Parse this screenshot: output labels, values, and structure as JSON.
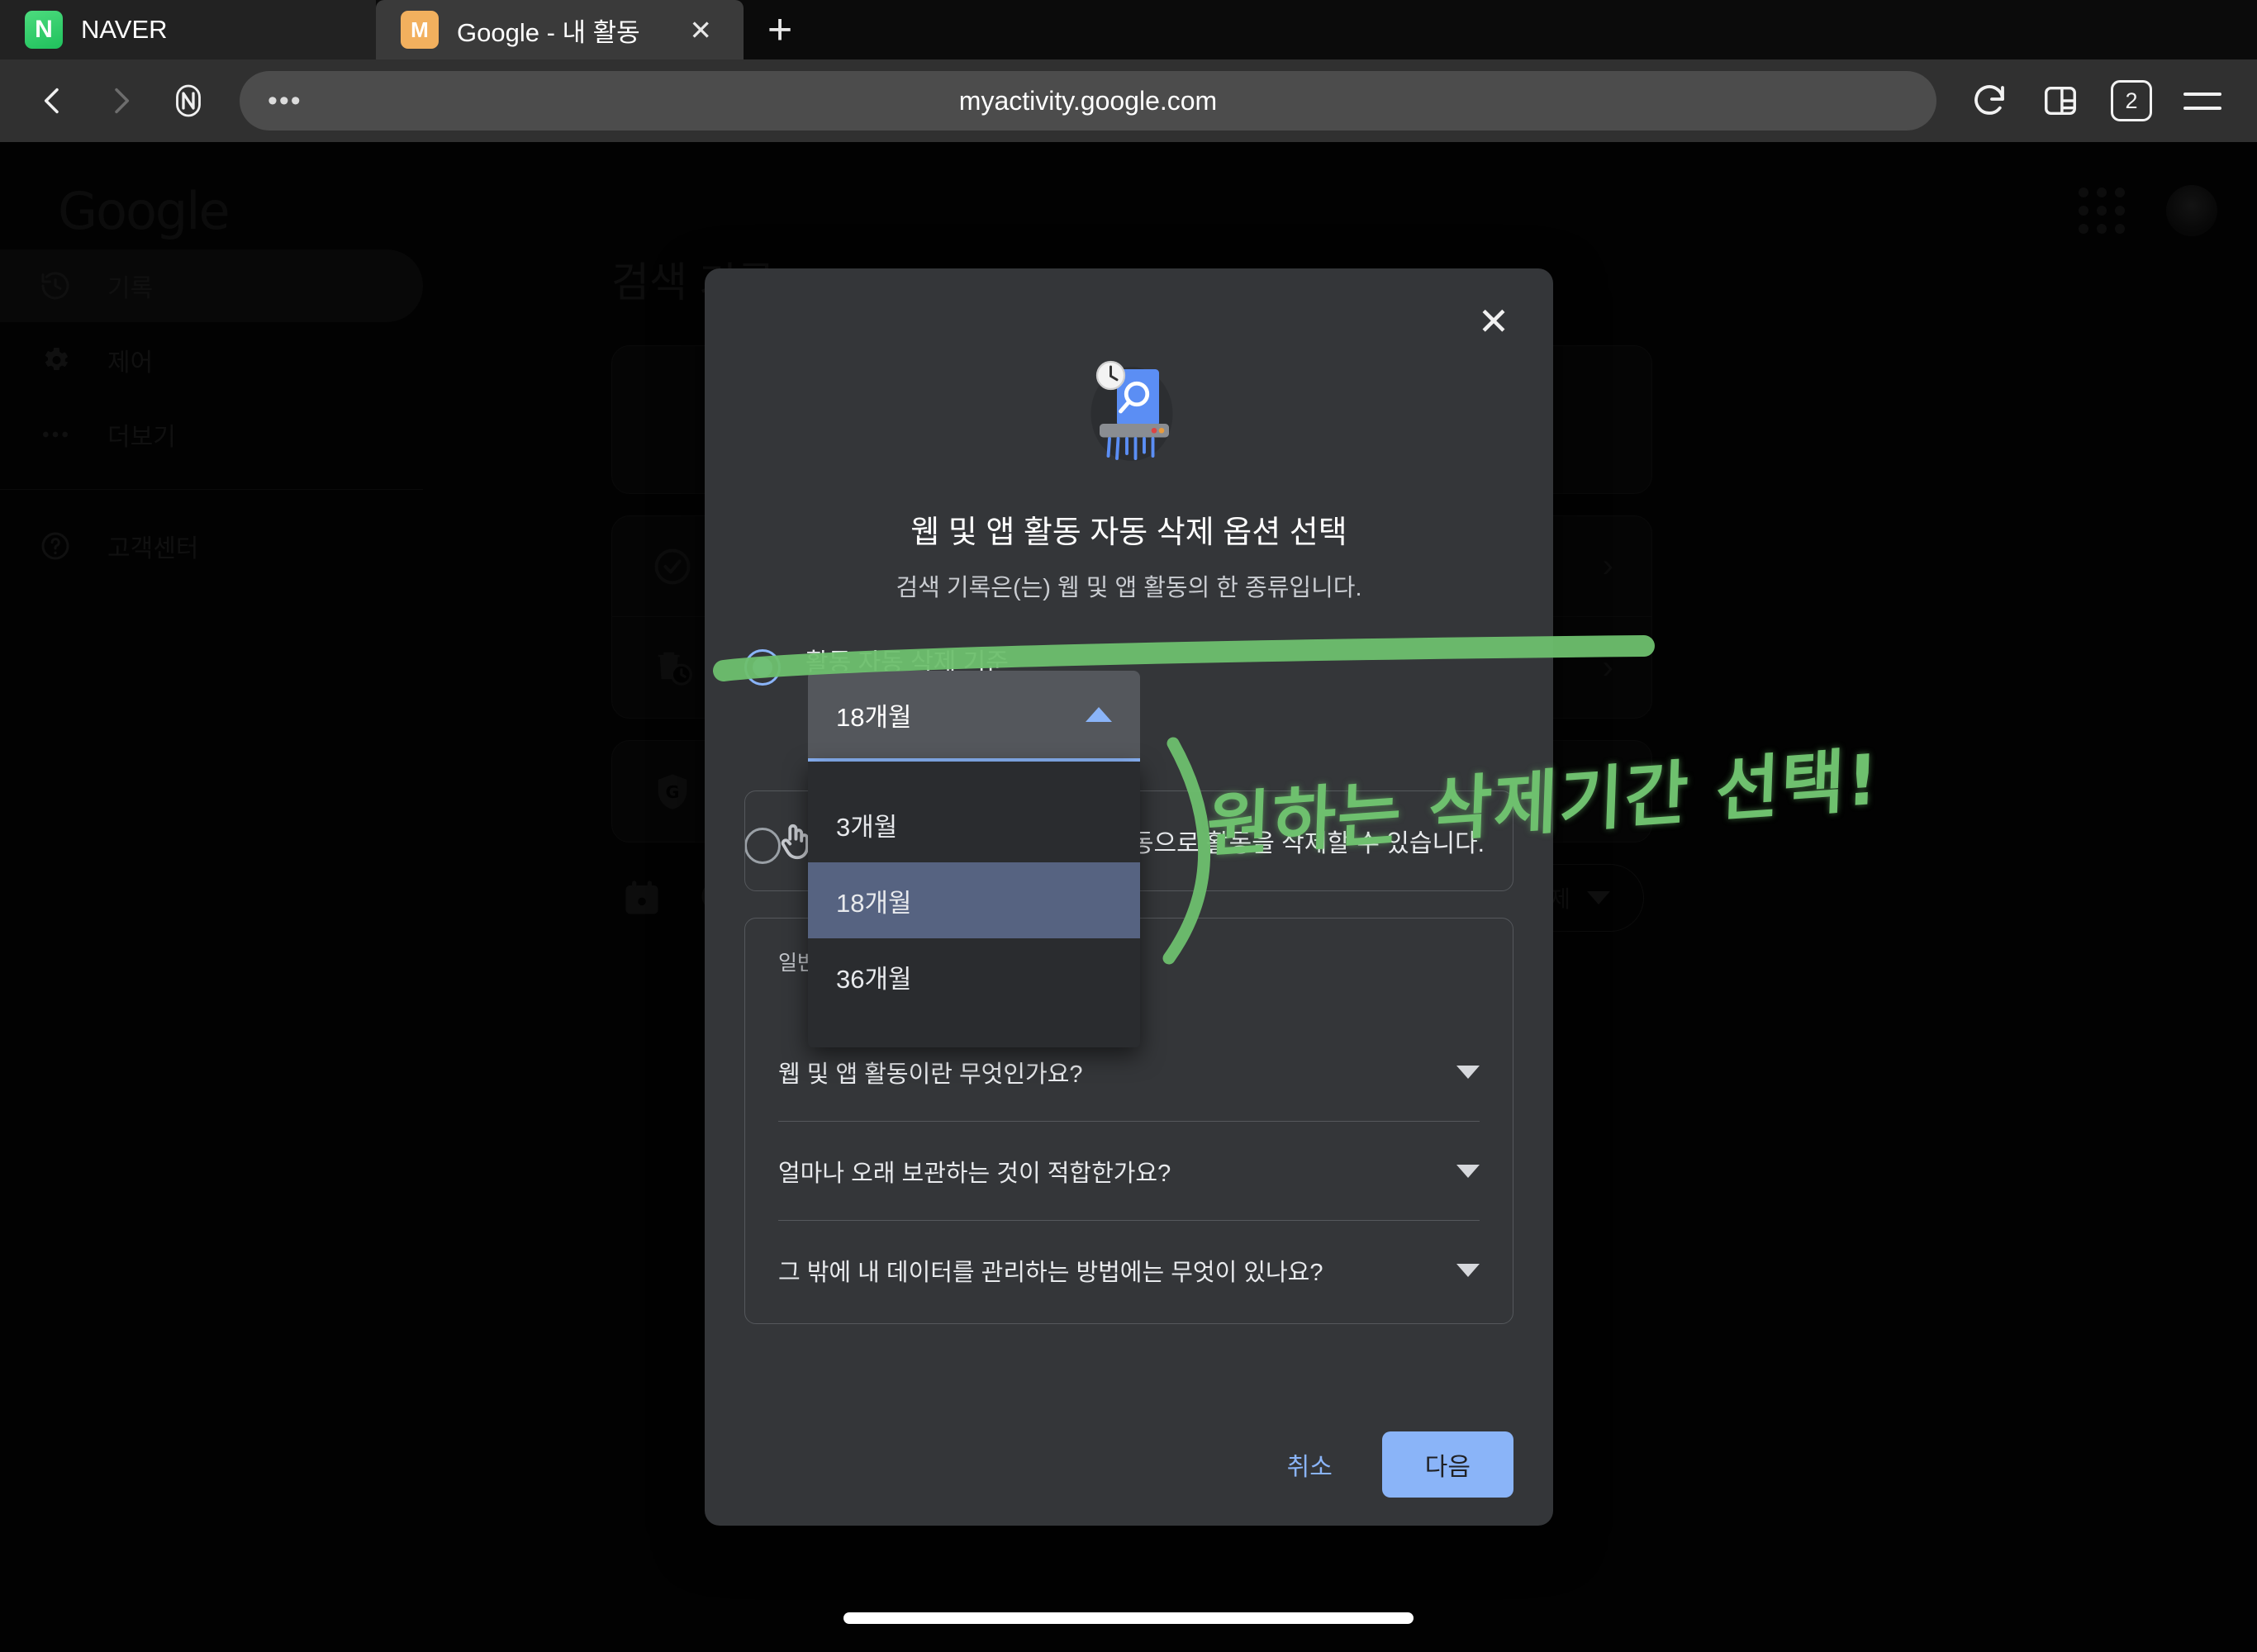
{
  "browser": {
    "tabs": [
      {
        "title": "NAVER",
        "favicon_letter": "N",
        "favicon": "naver-favicon",
        "active": false
      },
      {
        "title": "Google - 내 활동",
        "favicon_letter": "M",
        "favicon": "gmail-favicon",
        "active": true
      }
    ],
    "new_tab_label": "+",
    "close_label": "✕",
    "url": "myactivity.google.com",
    "url_overflow": "•••",
    "tab_count": "2",
    "icons": {
      "back": "back-arrow-icon",
      "forward": "forward-arrow-icon",
      "naver_shortcut": "naver-badge-icon",
      "reload": "reload-icon",
      "split_view": "split-view-icon",
      "tab_switcher": "tab-count-icon",
      "menu": "hamburger-menu-icon"
    }
  },
  "page": {
    "logo": "Google",
    "title": "검색 기록",
    "sidebar": [
      {
        "label": "기록",
        "icon": "history-icon",
        "active": true
      },
      {
        "label": "제어",
        "icon": "gear-icon",
        "active": false
      },
      {
        "label": "더보기",
        "icon": "ellipsis-icon",
        "active": false
      },
      {
        "label": "고객센터",
        "icon": "help-circle-icon",
        "active": false
      }
    ],
    "cards": [
      {
        "icon": "google-activity-ring-icon",
        "type": "hero"
      },
      {
        "icon": "check-circle-icon",
        "type": "row"
      },
      {
        "icon": "auto-delete-icon",
        "type": "row"
      },
      {
        "icon": "google-shield-icon",
        "type": "row"
      }
    ],
    "filter": {
      "date_icon": "calendar-icon",
      "search_icon": "search-icon",
      "delete_label": "삭제",
      "delete_caret": "chevron-down-icon"
    }
  },
  "modal": {
    "close_label": "✕",
    "illustration": "shredder-clock-search-icon",
    "title": "웹 및 앱 활동 자동 삭제 옵션 선택",
    "subtitle": "검색 기록은(는) 웹 및 앱 활동의 한 종류입니다.",
    "options": [
      {
        "label": "활동 자동 삭제 기준",
        "checked": true
      },
      {
        "label": "",
        "checked": false
      }
    ],
    "select": {
      "value": "18개월",
      "expanded": true,
      "caret": "caret-up-icon",
      "items": [
        {
          "label": "3개월",
          "selected": false
        },
        {
          "label": "18개월",
          "selected": true
        },
        {
          "label": "36개월",
          "selected": false
        }
      ]
    },
    "manual_note": {
      "icon": "hand-tap-icon",
      "text": "수동으로 활동을 삭제할 수 있습니다."
    },
    "faq": {
      "heading": "일반적인 질문",
      "items": [
        {
          "question": "웹 및 앱 활동이란 무엇인가요?",
          "caret": "chevron-down-icon"
        },
        {
          "question": "얼마나 오래 보관하는 것이 적합한가요?",
          "caret": "chevron-down-icon"
        },
        {
          "question": "그 밖에 내 데이터를 관리하는 방법에는 무엇이 있나요?",
          "caret": "chevron-down-icon"
        }
      ]
    },
    "footer": {
      "cancel_label": "취소",
      "next_label": "다음"
    }
  },
  "annotation": {
    "text": "원하는 삭제기간 선택!",
    "color": "#6ec06e",
    "shape": "bracket-and-handwriting"
  },
  "colors": {
    "accent_blue": "#8ab4f8",
    "modal_bg": "#343639",
    "highlight_green": "#6ec06e",
    "selected_option_bg": "#566381"
  }
}
